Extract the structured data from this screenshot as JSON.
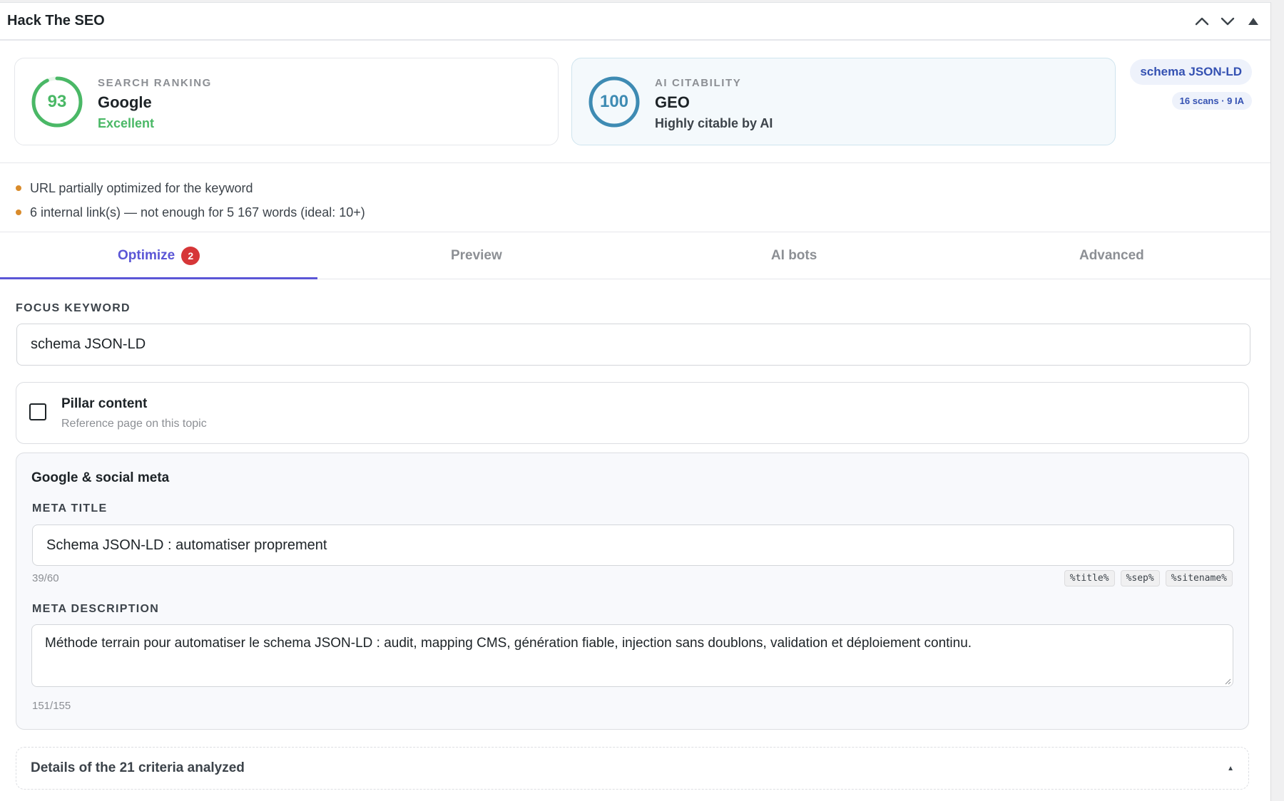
{
  "header": {
    "title": "Hack The SEO",
    "move_up_icon": "chevron-up-icon",
    "move_down_icon": "chevron-down-icon",
    "toggle_icon": "triangle-up-icon"
  },
  "scores": {
    "google": {
      "label": "SEARCH RANKING",
      "name": "Google",
      "score": "93",
      "score_fraction": 0.93,
      "status": "Excellent",
      "color": "#4ab866"
    },
    "geo": {
      "label": "AI CITABILITY",
      "name": "GEO",
      "score": "100",
      "score_fraction": 1.0,
      "status": "Highly citable by AI",
      "color": "#3e8bb3"
    },
    "keyword_pill": "schema JSON-LD",
    "scans_pill": "16 scans · 9 IA"
  },
  "issues": [
    {
      "text": "URL partially optimized for the keyword"
    },
    {
      "text": "6 internal link(s) — not enough for 5 167 words (ideal: 10+)"
    }
  ],
  "tabs": [
    {
      "label": "Optimize",
      "badge": "2",
      "active": true
    },
    {
      "label": "Preview"
    },
    {
      "label": "AI bots"
    },
    {
      "label": "Advanced"
    }
  ],
  "focus": {
    "label": "FOCUS KEYWORD",
    "value": "schema JSON-LD"
  },
  "pillar": {
    "title": "Pillar content",
    "subtitle": "Reference page on this topic",
    "checked": false
  },
  "meta": {
    "heading": "Google & social meta",
    "title_label": "META TITLE",
    "title_value": "Schema JSON-LD : automatiser proprement",
    "title_count": "39/60",
    "variables": [
      "%title%",
      "%sep%",
      "%sitename%"
    ],
    "description_label": "META DESCRIPTION",
    "description_value": "Méthode terrain pour automatiser le schema JSON-LD : audit, mapping CMS, génération fiable, injection sans doublons, validation et déploiement continu.",
    "description_count": "151/155"
  },
  "details": {
    "label": "Details of the 21 criteria analyzed"
  },
  "colors": {
    "accent": "#5b56d6",
    "badge": "#d63638",
    "warning_dot": "#d98b2b"
  }
}
